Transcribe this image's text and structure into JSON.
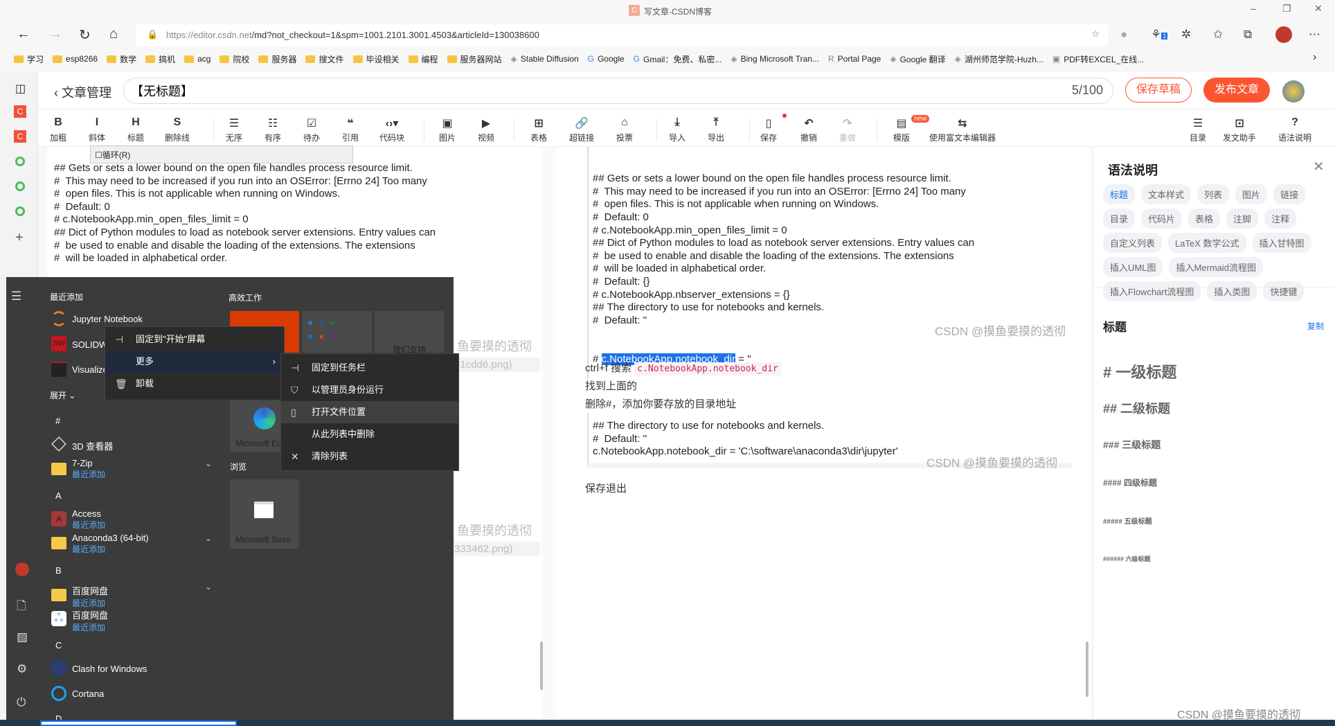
{
  "browser": {
    "window_title": "写文章-CSDN博客",
    "url_host": "https://editor.csdn.net",
    "url_path": "/md?not_checkout=1&spm=1001.2101.3001.4503&articleId=130038600",
    "extension_badge": "1"
  },
  "bookmarks": [
    {
      "label": "学习",
      "icon": "folder"
    },
    {
      "label": "esp8266",
      "icon": "folder"
    },
    {
      "label": "数学",
      "icon": "folder"
    },
    {
      "label": "搞机",
      "icon": "folder"
    },
    {
      "label": "acg",
      "icon": "folder"
    },
    {
      "label": "院校",
      "icon": "folder"
    },
    {
      "label": "服务器",
      "icon": "folder"
    },
    {
      "label": "搜文件",
      "icon": "folder"
    },
    {
      "label": "毕设相关",
      "icon": "folder"
    },
    {
      "label": "编程",
      "icon": "folder"
    },
    {
      "label": "服务器网站",
      "icon": "folder"
    },
    {
      "label": "Stable Diffusion",
      "icon": "sd"
    },
    {
      "label": "Google",
      "icon": "google"
    },
    {
      "label": "Gmail：免费、私密...",
      "icon": "google"
    },
    {
      "label": "Bing Microsoft Tran...",
      "icon": "bing"
    },
    {
      "label": "Portal Page",
      "icon": "portal"
    },
    {
      "label": "Google 翻译",
      "icon": "page"
    },
    {
      "label": "湖州师范学院-Huzh...",
      "icon": "school"
    },
    {
      "label": "PDF转EXCEL_在线...",
      "icon": "cs"
    }
  ],
  "editor": {
    "back_label": "文章管理",
    "title_value": "【无标题】",
    "title_count": "5/100",
    "save_draft": "保存草稿",
    "publish": "发布文章"
  },
  "toolbar": [
    {
      "label": "加粗",
      "glyph": "B"
    },
    {
      "label": "斜体",
      "glyph": "I"
    },
    {
      "label": "标题",
      "glyph": "H"
    },
    {
      "label": "删除线",
      "glyph": "S"
    },
    {
      "label": "无序",
      "glyph": "☰"
    },
    {
      "label": "有序",
      "glyph": "☷"
    },
    {
      "label": "待办",
      "glyph": "☑"
    },
    {
      "label": "引用",
      "glyph": "❝"
    },
    {
      "label": "代码块",
      "glyph": "‹›▾"
    },
    {
      "label": "图片",
      "glyph": "▣"
    },
    {
      "label": "视频",
      "glyph": "▶"
    },
    {
      "label": "表格",
      "glyph": "⊞"
    },
    {
      "label": "超链接",
      "glyph": "🔗"
    },
    {
      "label": "投票",
      "glyph": "⌂"
    },
    {
      "label": "导入",
      "glyph": "⤓"
    },
    {
      "label": "导出",
      "glyph": "⤒"
    },
    {
      "label": "保存",
      "glyph": "▯"
    },
    {
      "label": "撤销",
      "glyph": "↶"
    },
    {
      "label": "重做",
      "glyph": "↷"
    },
    {
      "label": "模版",
      "glyph": "▤"
    },
    {
      "label": "使用富文本编辑器",
      "glyph": "⇆"
    },
    {
      "label": "目录",
      "glyph": "☰"
    },
    {
      "label": "发文助手",
      "glyph": "⊡"
    },
    {
      "label": "语法说明",
      "glyph": "?"
    }
  ],
  "template_badge": "new",
  "find_dialog": {
    "loop_label": "循环(R)"
  },
  "left_code": [
    "## Gets or sets a lower bound on the open file handles process resource limit.",
    "#  This may need to be increased if you run into an OSError: [Errno 24] Too many",
    "#  open files. This is not applicable when running on Windows.",
    "#  Default: 0",
    "# c.NotebookApp.min_open_files_limit = 0",
    "",
    "## Dict of Python modules to load as notebook server extensions. Entry values can",
    "#  be used to enable and disable the loading of the extensions. The extensions",
    "#  will be loaded in alphabetical order."
  ],
  "left_ghost": {
    "wm1": "鱼要摸的透彻",
    "img1": "31cdd6.png)",
    "wm2": "鱼要摸的透彻",
    "img2": "333462.png)"
  },
  "preview": {
    "code1": [
      "## Gets or sets a lower bound on the open file handles process resource limit.",
      "#  This may need to be increased if you run into an OSError: [Errno 24] Too many",
      "#  open files. This is not applicable when running on Windows.",
      "#  Default: 0",
      "# c.NotebookApp.min_open_files_limit = 0",
      "",
      "## Dict of Python modules to load as notebook server extensions. Entry values can",
      "#  be used to enable and disable the loading of the extensions. The extensions",
      "#  will be loaded in alphabetical order.",
      "#  Default: {}",
      "# c.NotebookApp.nbserver_extensions = {}",
      "",
      "## The directory to use for notebooks and kernels.",
      "#  Default: ''"
    ],
    "last_prefix": "# ",
    "last_selected": "c.NotebookApp.notebook_dir",
    "last_suffix": " = ''",
    "watermark": "CSDN @摸鱼要摸的透彻",
    "search_text": "ctrl+f 搜索",
    "search_code": "c.NotebookApp.notebook_dir",
    "found": "找到上面的",
    "delete_hint": "删除#，添加你要存放的目录地址",
    "code2": [
      "## The directory to use for notebooks and kernels.",
      "#  Default: ''",
      "c.NotebookApp.notebook_dir = 'C:\\software\\anaconda3\\dir\\jupyter'"
    ],
    "save_exit": "保存退出"
  },
  "help": {
    "title": "语法说明",
    "tags": [
      "标题",
      "文本样式",
      "列表",
      "图片",
      "链接",
      "目录",
      "代码片",
      "表格",
      "注脚",
      "注释",
      "自定义列表",
      "LaTeX 数学公式",
      "插入甘特图",
      "插入UML图",
      "插入Mermaid流程图",
      "插入Flowchart流程图",
      "插入类图",
      "快捷键"
    ],
    "active_tag": "标题",
    "section": "标题",
    "copy": "复制",
    "headings": [
      "# 一级标题",
      "## 二级标题",
      "### 三级标题",
      "#### 四级标题",
      "##### 五级标题",
      "###### 六级标题"
    ]
  },
  "start_menu": {
    "recent_header": "最近添加",
    "expand": "展开",
    "work_header": "高效工作",
    "browse_header": "浏览",
    "apps": [
      {
        "name": "Jupyter Notebook"
      },
      {
        "name": "SOLIDW"
      },
      {
        "name": "Visualize"
      }
    ],
    "letter_hash": "#",
    "letter_a": "A",
    "letter_b": "B",
    "letter_c": "C",
    "letter_d": "D",
    "list": [
      {
        "name": "3D 查看器"
      },
      {
        "name": "7-Zip",
        "sub": "最近添加"
      },
      {
        "name": "Access",
        "sub": "最近添加"
      },
      {
        "name": "Anaconda3 (64-bit)",
        "sub": "最近添加"
      },
      {
        "name": "百度网盘",
        "sub": "最近添加"
      },
      {
        "name": "百度网盘",
        "sub": "最近添加"
      },
      {
        "name": "Clash for Windows"
      },
      {
        "name": "Cortana"
      }
    ],
    "tiles": {
      "support": "我们支持",
      "edge": "Microsoft Ec",
      "store": "Microsoft Store"
    }
  },
  "context_menu": {
    "items": [
      "固定到\"开始\"屏幕",
      "更多",
      "卸载"
    ]
  },
  "submenu": {
    "items": [
      "固定到任务栏",
      "以管理员身份运行",
      "打开文件位置",
      "从此列表中删除",
      "清除列表"
    ],
    "highlighted": "打开文件位置"
  },
  "bottom_watermark": "CSDN @摸鱼要摸的透彻"
}
